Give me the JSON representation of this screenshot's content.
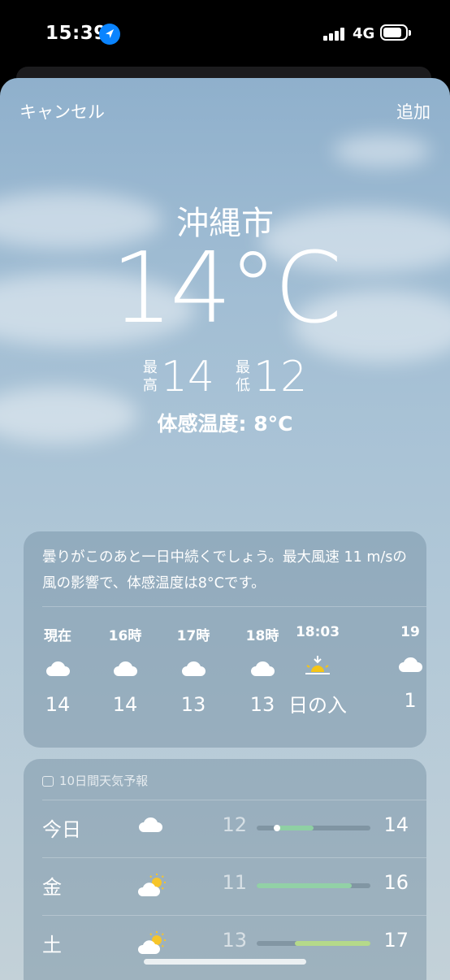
{
  "status_bar": {
    "time": "15:39",
    "network": "4G",
    "icons": [
      "location-arrow-icon",
      "signal-bars-icon",
      "battery-icon"
    ]
  },
  "nav": {
    "cancel_label": "キャンセル",
    "add_label": "追加"
  },
  "current": {
    "city": "沖縄市",
    "temperature": "14°C",
    "high_label_1": "最",
    "high_label_2": "高",
    "high": "14",
    "low_label_1": "最",
    "low_label_2": "低",
    "low": "12",
    "feels_like": "体感温度: 8°C"
  },
  "hourly": {
    "summary": "曇りがこのあと一日中続くでしょう。最大風速 11 m/sの風の影響で、体感温度は8°Cです。",
    "items": [
      {
        "label": "現在",
        "icon": "cloud-icon",
        "value": "14"
      },
      {
        "label": "16時",
        "icon": "cloud-icon",
        "value": "14"
      },
      {
        "label": "17時",
        "icon": "cloud-icon",
        "value": "13"
      },
      {
        "label": "18時",
        "icon": "cloud-icon",
        "value": "13"
      },
      {
        "label": "18:03",
        "icon": "sunset-icon",
        "value": "日の入"
      },
      {
        "label": "19",
        "icon": "cloud-icon",
        "value": "1"
      }
    ]
  },
  "forecast": {
    "title": "10日間天気予報",
    "temp_scale": [
      11,
      17
    ],
    "rows": [
      {
        "day": "今日",
        "icon": "cloud-icon",
        "low": "12",
        "high": "14",
        "low_val": 12,
        "high_val": 14,
        "current_val": 14,
        "color": "#8fd0a4"
      },
      {
        "day": "金",
        "icon": "partly-sunny-icon",
        "low": "11",
        "high": "16",
        "low_val": 11,
        "high_val": 16,
        "color": "#92d1a6"
      },
      {
        "day": "土",
        "icon": "partly-sunny-icon",
        "low": "13",
        "high": "17",
        "low_val": 13,
        "high_val": 17,
        "color": "#b5d98a"
      }
    ]
  },
  "colors": {
    "sunset_yellow": "#f5c518",
    "sun_yellow": "#f6c52a",
    "location_blue": "#0a84ff"
  }
}
